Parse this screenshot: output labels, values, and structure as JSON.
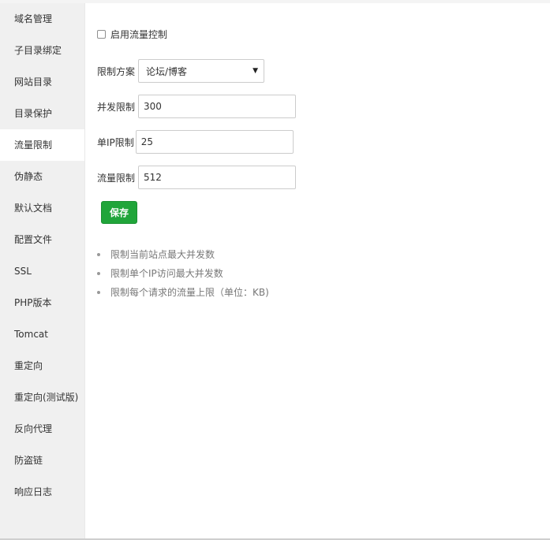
{
  "sidebar": {
    "items": [
      {
        "label": "域名管理"
      },
      {
        "label": "子目录绑定"
      },
      {
        "label": "网站目录"
      },
      {
        "label": "目录保护"
      },
      {
        "label": "流量限制"
      },
      {
        "label": "伪静态"
      },
      {
        "label": "默认文档"
      },
      {
        "label": "配置文件"
      },
      {
        "label": "SSL"
      },
      {
        "label": "PHP版本"
      },
      {
        "label": "Tomcat"
      },
      {
        "label": "重定向"
      },
      {
        "label": "重定向(测试版)"
      },
      {
        "label": "反向代理"
      },
      {
        "label": "防盗链"
      },
      {
        "label": "响应日志"
      }
    ],
    "active_index": 4
  },
  "form": {
    "enable_label": "启用流量控制",
    "enable_checked": false,
    "scheme_label": "限制方案",
    "scheme_value": "论坛/博客",
    "concurrent_label": "并发限制",
    "concurrent_value": "300",
    "per_ip_label": "单IP限制",
    "per_ip_value": "25",
    "traffic_label": "流量限制",
    "traffic_value": "512",
    "save_label": "保存"
  },
  "tips": [
    "限制当前站点最大并发数",
    "限制单个IP访问最大并发数",
    "限制每个请求的流量上限（单位：KB)"
  ],
  "colors": {
    "accent": "#20a53a",
    "sidebar_bg": "#f0f0f0"
  }
}
